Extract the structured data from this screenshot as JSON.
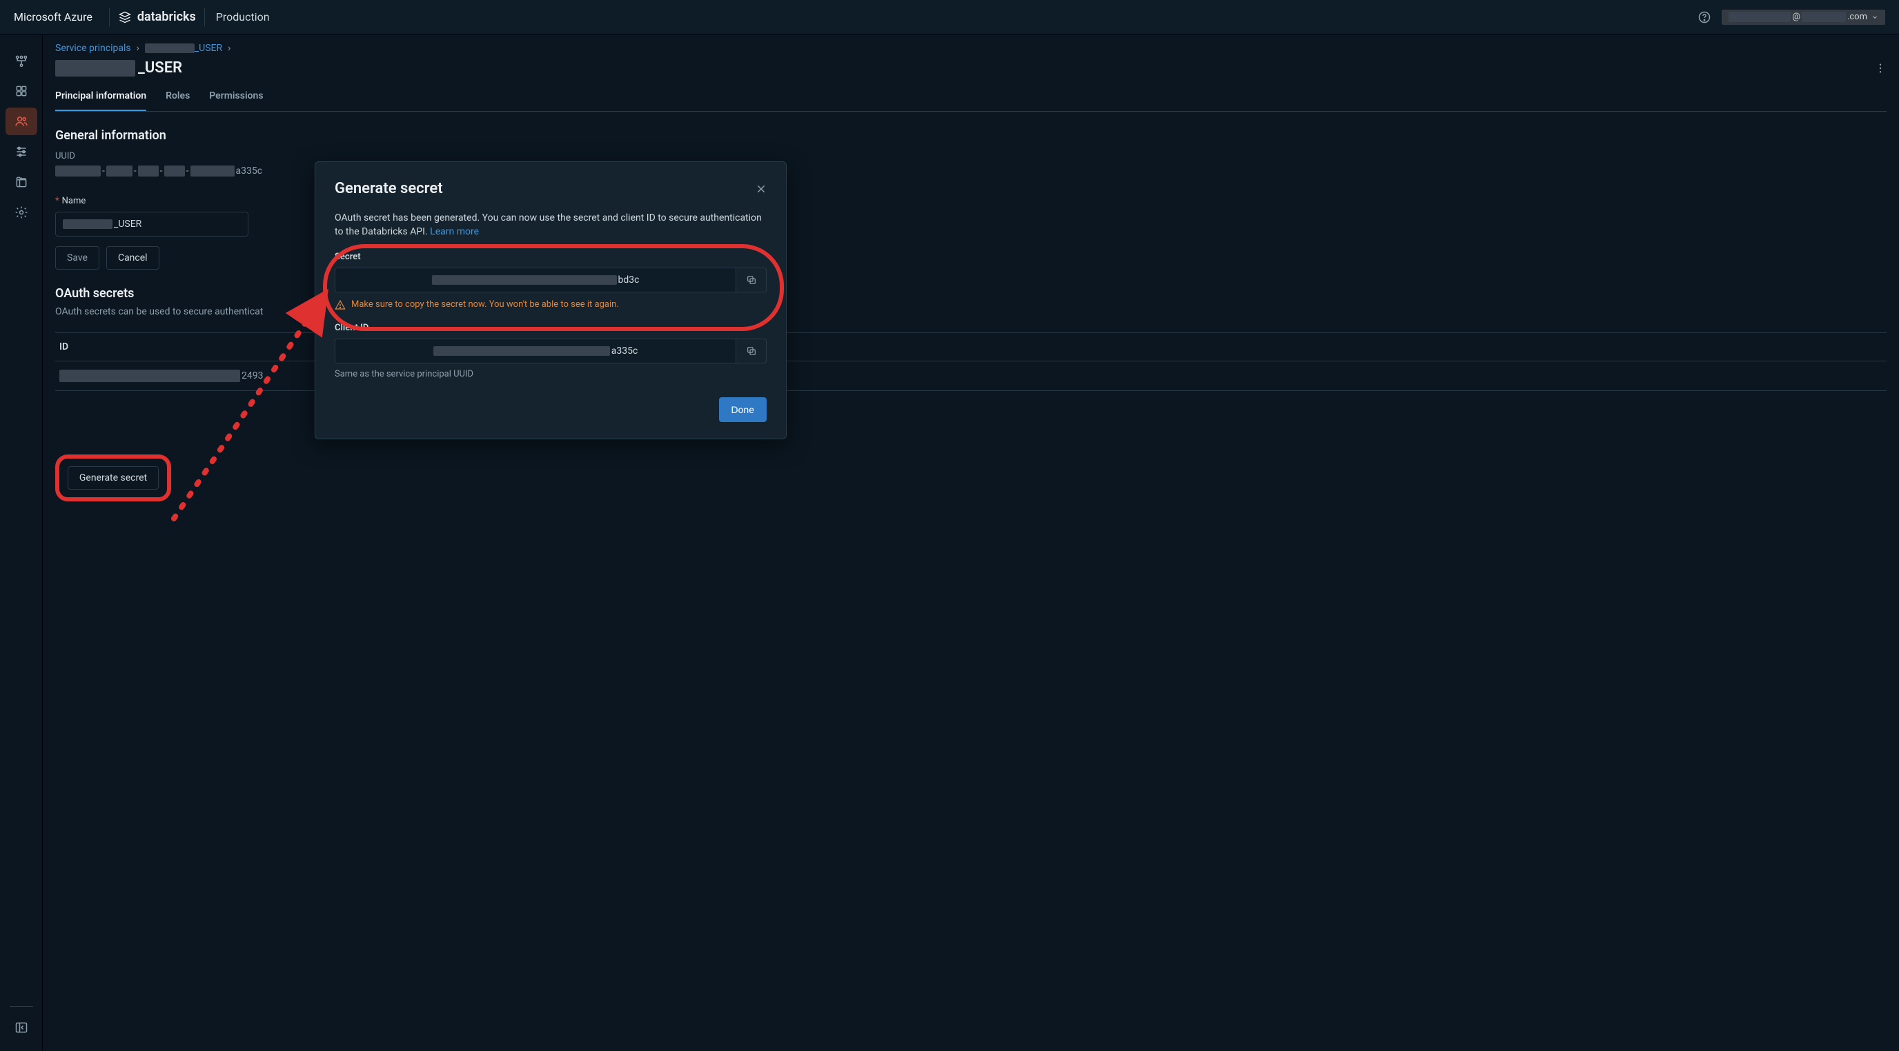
{
  "header": {
    "azure": "Microsoft Azure",
    "databricks": "databricks",
    "env": "Production",
    "user_email_middle": "@",
    "user_email_suffix": ".com"
  },
  "breadcrumb": {
    "root": "Service principals",
    "current_suffix": "_USER"
  },
  "page": {
    "title_suffix": "_USER",
    "tabs": [
      "Principal information",
      "Roles",
      "Permissions"
    ],
    "general_heading": "General information",
    "uuid_label": "UUID",
    "uuid_suffix": "a335c",
    "name_label": "Name",
    "name_value_suffix": "_USER",
    "save": "Save",
    "cancel": "Cancel",
    "oauth_heading": "OAuth secrets",
    "oauth_desc": "OAuth secrets can be used to secure authenticat",
    "id_col": "ID",
    "row_id_suffix": "2493",
    "generate_secret": "Generate secret"
  },
  "modal": {
    "title": "Generate secret",
    "desc": "OAuth secret has been generated. You can now use the secret and client ID to secure authentication to the Databricks API.",
    "learn_more": "Learn more",
    "secret_label": "Secret",
    "secret_suffix": "bd3c",
    "warn": "Make sure to copy the secret now. You won't be able to see it again.",
    "clientid_label": "Client ID",
    "clientid_suffix": "a335c",
    "clientid_hint": "Same as the service principal UUID",
    "done": "Done"
  }
}
